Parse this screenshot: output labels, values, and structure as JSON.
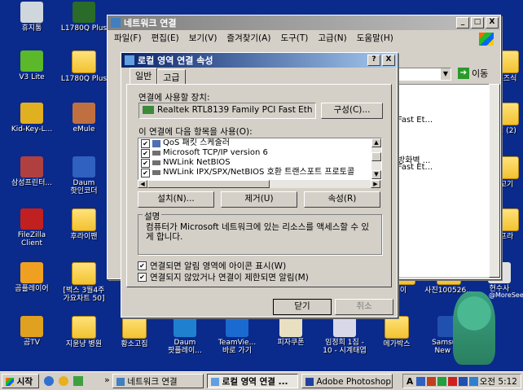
{
  "desktop": {
    "icons": [
      {
        "label": "휴지통"
      },
      {
        "label": "L1780Q Plus"
      },
      {
        "label": "V3 Lite"
      },
      {
        "label": "L1780Q Plus"
      },
      {
        "label": "Kid-Key-L..."
      },
      {
        "label": "eMule"
      },
      {
        "label": "삼성프린터..."
      },
      {
        "label": "Daum\n핫인코더"
      },
      {
        "label": "FileZilla\nClient"
      },
      {
        "label": "후라이팬"
      },
      {
        "label": "곰플레이어"
      },
      {
        "label": "[벅스 3월4주\n가요차트 50]"
      },
      {
        "label": "곰TV"
      },
      {
        "label": "지윤냥 병원"
      },
      {
        "label": "황소고집"
      },
      {
        "label": "Daum\n팟플레이..."
      },
      {
        "label": "TeamVie...\n바로 가기"
      },
      {
        "label": "피자쿠폰"
      },
      {
        "label": "임정희 1집 -\n10 - 시계태엽"
      },
      {
        "label": "메가박스"
      },
      {
        "label": "Samsung\nNew P..."
      },
      {
        "label": "이"
      },
      {
        "label": "사진100526..."
      },
      {
        "label": "현수사"
      },
      {
        "label": "혼즈식"
      },
      {
        "label": "더 (2)"
      },
      {
        "label": "고기"
      },
      {
        "label": "프라"
      }
    ],
    "watermark": "@MoreSee"
  },
  "net_window": {
    "title": "네트워크 연결",
    "menu": [
      "파일(F)",
      "편집(E)",
      "보기(V)",
      "즐겨찾기(A)",
      "도구(T)",
      "고급(N)",
      "도움말(H)"
    ],
    "go_label": "이동",
    "bg_items": [
      "Fast Et...",
      "Fast Et...",
      "방화벽 ...",
      "Fast Et..."
    ],
    "title_buttons": [
      "_",
      "□",
      "X"
    ]
  },
  "dialog": {
    "title": "로컬 영역 연결 속성",
    "title_buttons": [
      "?",
      "X"
    ],
    "tabs": [
      "일반",
      "고급"
    ],
    "connect_using_label": "연결에 사용할 장치:",
    "device": "Realtek RTL8139 Family PCI Fast Eth",
    "configure": "구성(C)...",
    "items_label": "이 연결에 다음 항목을 사용(O):",
    "items": [
      {
        "label": "QoS 패킷 스케줄러",
        "checked": true
      },
      {
        "label": "Microsoft TCP/IP version 6",
        "checked": true
      },
      {
        "label": "NWLink NetBIOS",
        "checked": true
      },
      {
        "label": "NWLink IPX/SPX/NetBIOS 호환 트랜스포트 프로토콜",
        "checked": true
      }
    ],
    "install": "설치(N)...",
    "uninstall": "제거(U)",
    "properties": "속성(R)",
    "desc_title": "설명",
    "desc_text": "컴퓨터가 Microsoft 네트워크에 있는 리소스를 액세스할 수 있게 합니다.",
    "check1": "연결되면 알림 영역에 아이콘 표시(W)",
    "check2": "연결되지 않았거나 연결이 제한되면 알림(M)",
    "ok": "닫기",
    "cancel": "취소"
  },
  "taskbar": {
    "start": "시작",
    "items": [
      {
        "label": "네트워크 연결"
      },
      {
        "label": "로컬 영역 연결 ..."
      },
      {
        "label": "Adobe Photoshop..."
      }
    ],
    "chevron": "»",
    "ime": "A",
    "clock": "오전 5:12"
  }
}
